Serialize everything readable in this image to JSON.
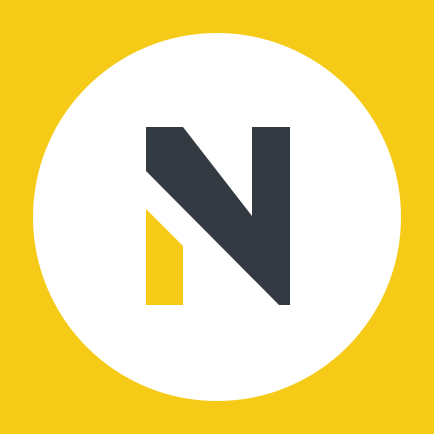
{
  "icon": {
    "name": "logo-n-icon",
    "colors": {
      "background": "#F6CB17",
      "circle": "#FFFFFF",
      "letter_dark": "#333A42",
      "letter_accent": "#F6CB17"
    }
  }
}
